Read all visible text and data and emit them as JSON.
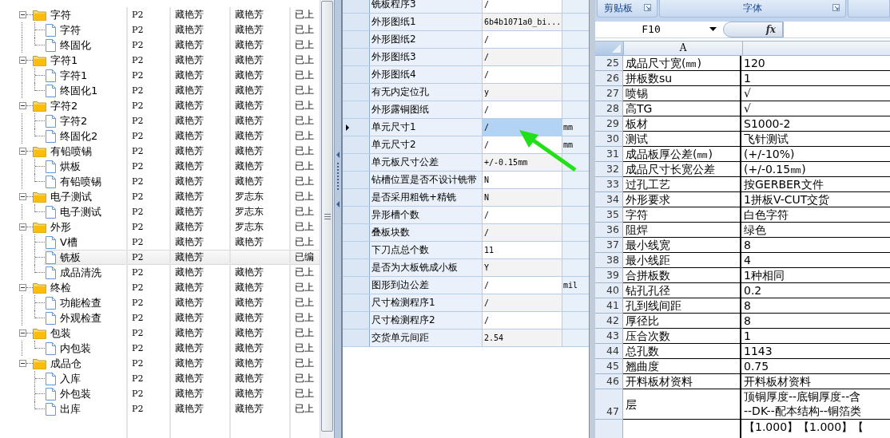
{
  "task_tree": {
    "nodes": [
      {
        "kind": "group",
        "label": "字符",
        "column_2": "P2",
        "column_3": "藏艳芳",
        "column_4": "藏艳芳",
        "column_5": "已上",
        "selected": false,
        "expanded": true,
        "children": [
          {
            "label": "字符",
            "column_2": "P2",
            "column_3": "藏艳芳",
            "column_4": "藏艳芳",
            "column_5": "已上",
            "selected": false
          },
          {
            "label": "终固化",
            "column_2": "P2",
            "column_3": "藏艳芳",
            "column_4": "藏艳芳",
            "column_5": "已上",
            "selected": false
          }
        ]
      },
      {
        "kind": "group",
        "label": "字符1",
        "column_2": "P2",
        "column_3": "藏艳芳",
        "column_4": "藏艳芳",
        "column_5": "已上",
        "selected": false,
        "expanded": true,
        "children": [
          {
            "label": "字符1",
            "column_2": "P2",
            "column_3": "藏艳芳",
            "column_4": "藏艳芳",
            "column_5": "已上",
            "selected": false
          },
          {
            "label": "终固化1",
            "column_2": "P2",
            "column_3": "藏艳芳",
            "column_4": "藏艳芳",
            "column_5": "已上",
            "selected": false
          }
        ]
      },
      {
        "kind": "group",
        "label": "字符2",
        "column_2": "P2",
        "column_3": "藏艳芳",
        "column_4": "藏艳芳",
        "column_5": "已上",
        "selected": false,
        "expanded": true,
        "children": [
          {
            "label": "字符2",
            "column_2": "P2",
            "column_3": "藏艳芳",
            "column_4": "藏艳芳",
            "column_5": "已上",
            "selected": false
          },
          {
            "label": "终固化2",
            "column_2": "P2",
            "column_3": "藏艳芳",
            "column_4": "藏艳芳",
            "column_5": "已上",
            "selected": false
          }
        ]
      },
      {
        "kind": "group",
        "label": "有铅喷锡",
        "column_2": "P2",
        "column_3": "藏艳芳",
        "column_4": "藏艳芳",
        "column_5": "已上",
        "selected": false,
        "expanded": true,
        "children": [
          {
            "label": "烘板",
            "column_2": "P2",
            "column_3": "藏艳芳",
            "column_4": "藏艳芳",
            "column_5": "已上",
            "selected": false
          },
          {
            "label": "有铅喷锡",
            "column_2": "P2",
            "column_3": "藏艳芳",
            "column_4": "藏艳芳",
            "column_5": "已上",
            "selected": false
          }
        ]
      },
      {
        "kind": "group",
        "label": "电子测试",
        "column_2": "P2",
        "column_3": "藏艳芳",
        "column_4": "罗志东",
        "column_5": "已上",
        "selected": false,
        "expanded": true,
        "children": [
          {
            "label": "电子测试",
            "column_2": "P2",
            "column_3": "藏艳芳",
            "column_4": "罗志东",
            "column_5": "已上",
            "selected": false
          }
        ]
      },
      {
        "kind": "group",
        "label": "外形",
        "column_2": "P2",
        "column_3": "藏艳芳",
        "column_4": "罗志东",
        "column_5": "已上",
        "selected": false,
        "expanded": true,
        "children": [
          {
            "label": "V槽",
            "column_2": "P2",
            "column_3": "藏艳芳",
            "column_4": "藏艳芳",
            "column_5": "已上",
            "selected": false
          },
          {
            "label": "铣板",
            "column_2": "P2",
            "column_3": "藏艳芳",
            "column_5": "已编",
            "selected": true
          },
          {
            "label": "成品清洗",
            "column_2": "P2",
            "column_3": "藏艳芳",
            "column_4": "藏艳芳",
            "column_5": "已上",
            "selected": false
          }
        ]
      },
      {
        "kind": "group",
        "label": "终检",
        "column_2": "P2",
        "column_3": "藏艳芳",
        "column_4": "藏艳芳",
        "column_5": "已上",
        "selected": false,
        "expanded": true,
        "children": [
          {
            "label": "功能检查",
            "column_2": "P2",
            "column_3": "藏艳芳",
            "column_4": "藏艳芳",
            "column_5": "已上",
            "selected": false
          },
          {
            "label": "外观检查",
            "column_2": "P2",
            "column_3": "藏艳芳",
            "column_4": "藏艳芳",
            "column_5": "已上",
            "selected": false
          }
        ]
      },
      {
        "kind": "group",
        "label": "包装",
        "column_2": "P2",
        "column_3": "藏艳芳",
        "column_4": "藏艳芳",
        "column_5": "已上",
        "selected": false,
        "expanded": true,
        "children": [
          {
            "label": "内包装",
            "column_2": "P2",
            "column_3": "藏艳芳",
            "column_4": "藏艳芳",
            "column_5": "已上",
            "selected": false
          }
        ]
      },
      {
        "kind": "group",
        "label": "成品仓",
        "column_2": "P2",
        "column_3": "藏艳芳",
        "column_4": "藏艳芳",
        "column_5": "已上",
        "selected": false,
        "expanded": true,
        "children": [
          {
            "label": "入库",
            "column_2": "P2",
            "column_3": "藏艳芳",
            "column_4": "藏艳芳",
            "column_5": "已上",
            "selected": false
          },
          {
            "label": "外包装",
            "column_2": "P2",
            "column_3": "藏艳芳",
            "column_4": "藏艳芳",
            "column_5": "已上",
            "selected": false
          },
          {
            "label": "出库",
            "column_2": "P2",
            "column_3": "藏艳芳",
            "column_4": "藏艳芳",
            "column_5": "已上",
            "selected": false
          }
        ]
      }
    ]
  },
  "properties": {
    "rows": [
      {
        "name": "铣板程序3",
        "value": "/",
        "selected": false
      },
      {
        "name": "外形图纸1",
        "value": "6b4b1071a0_bi...",
        "selected": false
      },
      {
        "name": "外形图纸2",
        "value": "/",
        "selected": false
      },
      {
        "name": "外形图纸3",
        "value": "/",
        "selected": false
      },
      {
        "name": "外形图纸4",
        "value": "/",
        "selected": false
      },
      {
        "name": "有无内定位孔",
        "value": "y",
        "selected": false
      },
      {
        "name": "外形露铜图纸",
        "value": "/",
        "selected": false
      },
      {
        "name": "单元尺寸1",
        "value": "/",
        "unit": "mm",
        "selected": true
      },
      {
        "name": "单元尺寸2",
        "value": "/",
        "unit": "mm",
        "selected": false
      },
      {
        "name": "单元板尺寸公差",
        "value": "+/-0.15mm",
        "selected": false
      },
      {
        "name": "钻槽位置是否不设计铣带",
        "value": "N",
        "selected": false
      },
      {
        "name": "是否采用粗铣+精铣",
        "value": "N",
        "selected": false
      },
      {
        "name": "异形槽个数",
        "value": "/",
        "selected": false
      },
      {
        "name": "叠板块数",
        "value": "/",
        "selected": false
      },
      {
        "name": "下刀点总个数",
        "value": "11",
        "selected": false
      },
      {
        "name": "是否为大板铣成小板",
        "value": "Y",
        "selected": false
      },
      {
        "name": "图形到边公差",
        "value": "/",
        "unit": "mil",
        "selected": false
      },
      {
        "name": "尺寸检测程序1",
        "value": "/",
        "selected": false
      },
      {
        "name": "尺寸检测程序2",
        "value": "/",
        "selected": false
      },
      {
        "name": "交货单元间距",
        "value": "2.54",
        "selected": false
      }
    ]
  },
  "spreadsheet": {
    "ribbon_groups": [
      {
        "label": "剪贴板"
      },
      {
        "label": "字体"
      }
    ],
    "name_box": "F10",
    "function_button": "fx",
    "column_headers": [
      "A"
    ],
    "rows": [
      {
        "row": "25",
        "a": "成品尺寸宽(㎜)",
        "b": "120"
      },
      {
        "row": "26",
        "a": "拼板数su",
        "b": "1"
      },
      {
        "row": "27",
        "a": "喷锡",
        "b": "√"
      },
      {
        "row": "28",
        "a": "高TG",
        "b": "√"
      },
      {
        "row": "29",
        "a": "板材",
        "b": "S1000-2"
      },
      {
        "row": "30",
        "a": "测试",
        "b": "飞针测试"
      },
      {
        "row": "31",
        "a": "成品板厚公差(㎜)",
        "b": "(+/-10%)"
      },
      {
        "row": "32",
        "a": "成品尺寸长宽公差",
        "b": "(+/-0.15㎜)"
      },
      {
        "row": "33",
        "a": "过孔工艺",
        "b": "按GERBER文件"
      },
      {
        "row": "34",
        "a": "外形要求",
        "b": "1拼板V-CUT交货"
      },
      {
        "row": "35",
        "a": "字符",
        "b": "白色字符"
      },
      {
        "row": "36",
        "a": "阻焊",
        "b": "绿色"
      },
      {
        "row": "37",
        "a": "最小线宽",
        "b": "8"
      },
      {
        "row": "38",
        "a": "最小线距",
        "b": "4"
      },
      {
        "row": "39",
        "a": "合拼板数",
        "b": "1种相同"
      },
      {
        "row": "40",
        "a": "钻孔孔径",
        "b": "0.2"
      },
      {
        "row": "41",
        "a": "孔到线间距",
        "b": "8"
      },
      {
        "row": "42",
        "a": "厚径比",
        "b": "8"
      },
      {
        "row": "43",
        "a": "压合次数",
        "b": "1"
      },
      {
        "row": "44",
        "a": "总孔数",
        "b": "1143"
      },
      {
        "row": "45",
        "a": "翘曲度",
        "b": "0.75"
      },
      {
        "row": "46",
        "a": "开料板材资料",
        "b": "开料板材资料"
      },
      {
        "row": "47",
        "a": "层",
        "b": "顶铜厚度--底铜厚度--含",
        "b_line_2": "--DK--配本结构--铜箔类",
        "kind": "tall"
      },
      {
        "b": "【1.000】【1.000】【",
        "kind": "last"
      }
    ]
  }
}
